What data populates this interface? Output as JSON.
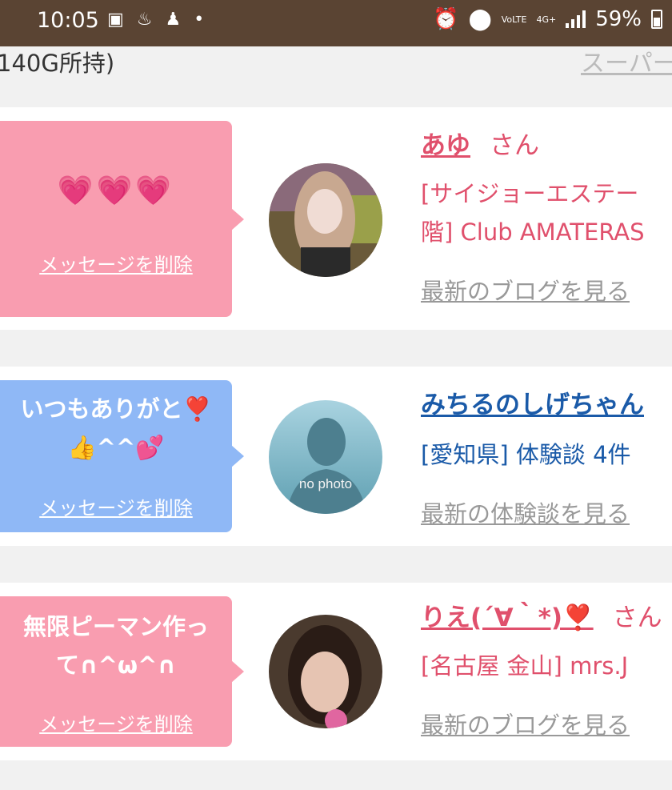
{
  "status_bar": {
    "time": "10:05",
    "volte": "VoLTE",
    "network": "4G+",
    "battery": "59%"
  },
  "top": {
    "gold_text": "140G所持)",
    "super_link": "スーパー"
  },
  "cards": [
    {
      "message": "💗💗💗",
      "delete_label": "メッセージを削除",
      "name": "あゆ",
      "honorific": "さん",
      "info_line1": "[サイジョーエステー",
      "info_line2": "階] Club AMATERAS",
      "more_link": "最新のブログを見る",
      "bubble_color": "#f99db0"
    },
    {
      "message_line1": "いつもありがと❣️",
      "message_line2": "👍^^💕",
      "delete_label": "メッセージを削除",
      "avatar_text": "no photo",
      "name": "みちるのしげちゃん",
      "info_line1": "[愛知県] 体験談 4件",
      "more_link": "最新の体験談を見る",
      "bubble_color": "#8fb8f6"
    },
    {
      "message_line1": "無限ピーマン作っ",
      "message_line2": "て∩^ω^∩",
      "delete_label": "メッセージを削除",
      "name": "りえ(´∀｀*)❣️",
      "honorific": "さん",
      "info_line1": "[名古屋 金山] mrs.J",
      "more_link": "最新のブログを見る",
      "bubble_color": "#f99db0"
    }
  ]
}
